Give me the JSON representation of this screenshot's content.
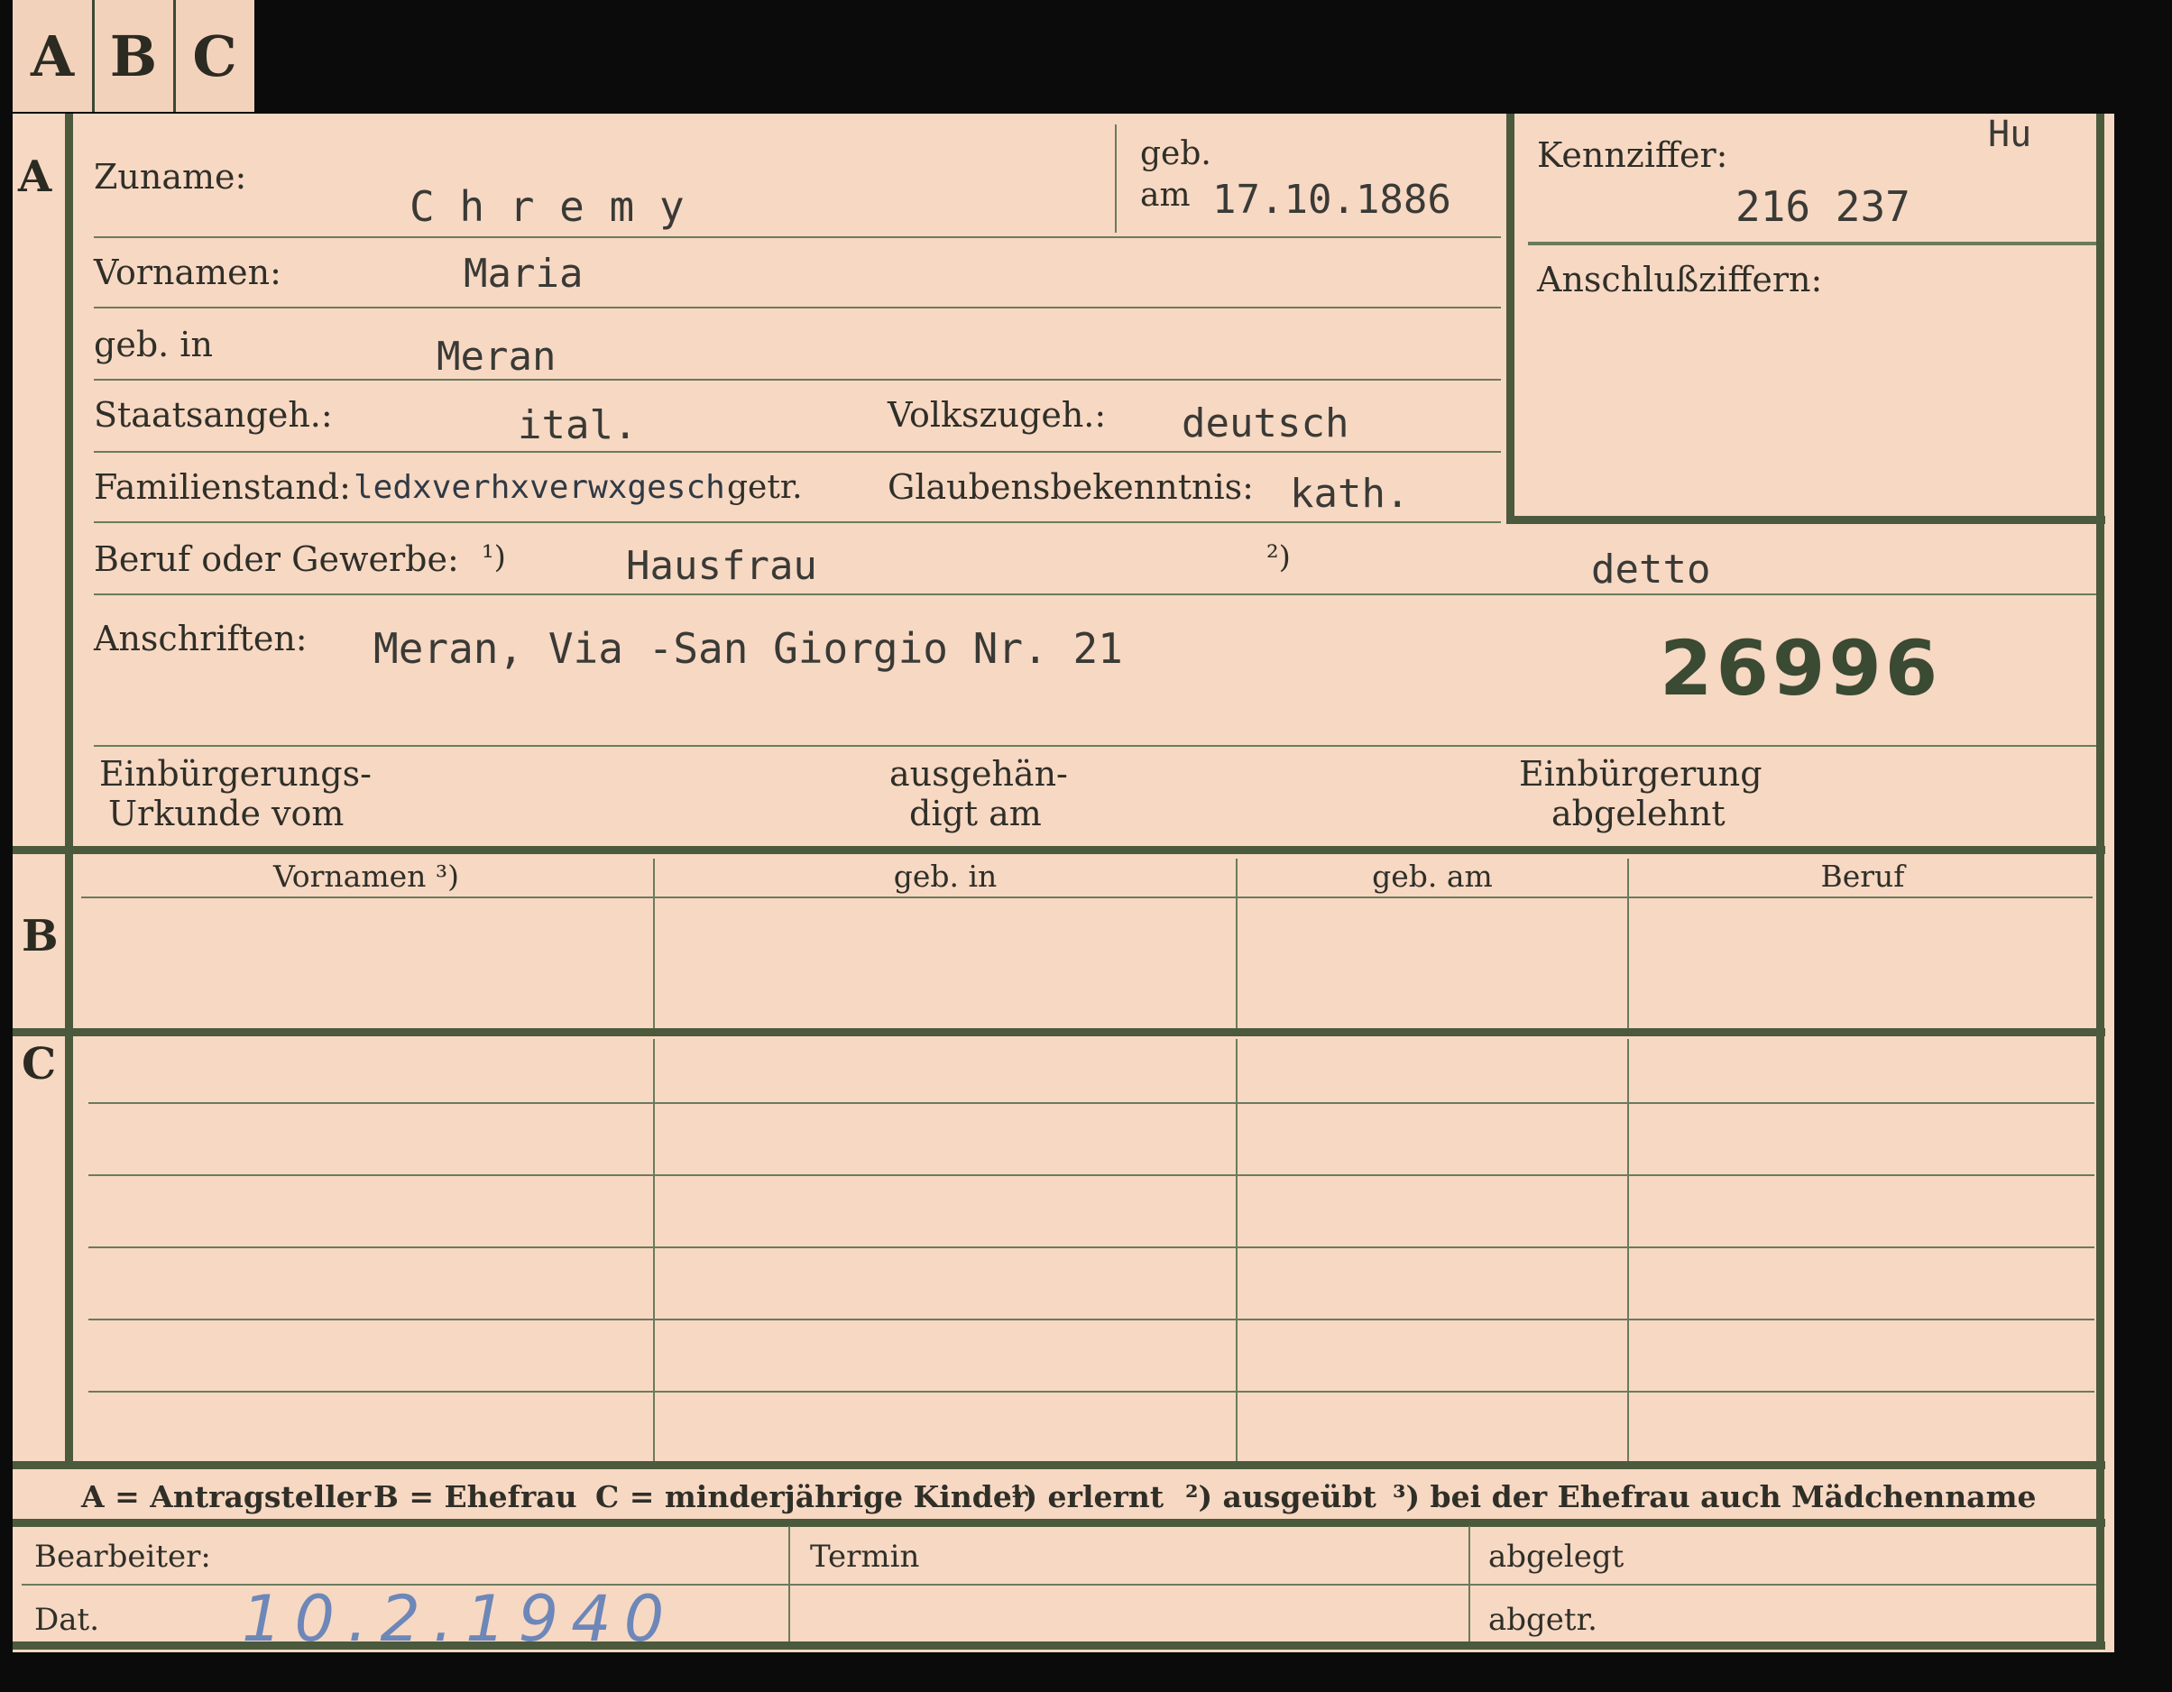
{
  "tabs": [
    "A",
    "B",
    "C"
  ],
  "section_a": {
    "letter": "A",
    "surname_label": "Zuname:",
    "surname_value": "C h r e m y",
    "born_label": "geb.",
    "born_on_label": "am",
    "born_on_value": "17.10.1886",
    "id_label": "Kennziffer:",
    "id_value": "216 237",
    "id_note": "Hu",
    "attached_label": "Anschlußziffern:",
    "firstname_label": "Vornamen:",
    "firstname_value": "Maria",
    "birthplace_label": "geb. in",
    "birthplace_value": "Meran",
    "citizenship_label": "Staatsangeh.:",
    "citizenship_value": "ital.",
    "ethnicity_label": "Volkszugeh.:",
    "ethnicity_value": "deutsch",
    "marital_label": "Familienstand:",
    "marital_struck": "ledxverhxverwxgesch",
    "marital_value": "getr.",
    "religion_label": "Glaubensbekenntnis:",
    "religion_value": "kath.",
    "occupation_label": "Beruf oder Gewerbe:",
    "occupation_note1": "¹)",
    "occupation_value1": "Hausfrau",
    "occupation_note2": "²)",
    "occupation_value2": "detto",
    "address_label": "Anschriften:",
    "address_value": "Meran, Via -San Giorgio Nr. 21",
    "stamp_number": "26996",
    "naturalization_label_1": "Einbürgerungs-",
    "naturalization_label_2": "Urkunde vom",
    "handed_label_1": "ausgehän-",
    "handed_label_2": "digt am",
    "refused_label_1": "Einbürgerung",
    "refused_label_2": "abgelehnt"
  },
  "section_b": {
    "letter": "B",
    "columns": [
      "Vornamen ³)",
      "geb. in",
      "geb. am",
      "Beruf"
    ]
  },
  "section_c": {
    "letter": "C"
  },
  "legend": {
    "a": "A = Antragsteller",
    "b": "B = Ehefrau",
    "c": "C = minderjährige Kinder",
    "n1": "¹) erlernt",
    "n2": "²) ausgeübt",
    "n3": "³) bei der Ehefrau auch Mädchenname"
  },
  "footer": {
    "clerk_label": "Bearbeiter:",
    "date_label": "Dat.",
    "date_value": "10.2.1940",
    "deadline_label": "Termin",
    "filed_label": "abgelegt",
    "filed2_label": "abgetr."
  }
}
